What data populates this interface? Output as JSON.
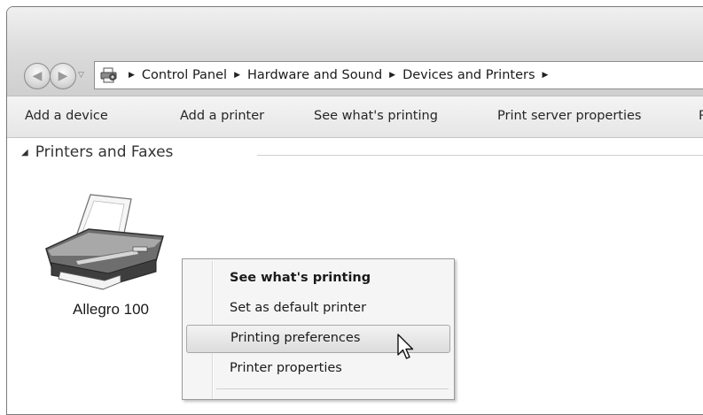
{
  "breadcrumb": {
    "items": [
      "Control Panel",
      "Hardware and Sound",
      "Devices and Printers"
    ]
  },
  "toolbar": {
    "items": [
      "Add a device",
      "Add a printer",
      "See what's printing",
      "Print server properties",
      "R"
    ]
  },
  "group": {
    "title": "Printers and Faxes"
  },
  "printer": {
    "name": "Allegro 100"
  },
  "context_menu": {
    "items": [
      "See what's printing",
      "Set as default printer",
      "Printing preferences",
      "Printer properties"
    ],
    "highlighted": "Printing preferences"
  }
}
